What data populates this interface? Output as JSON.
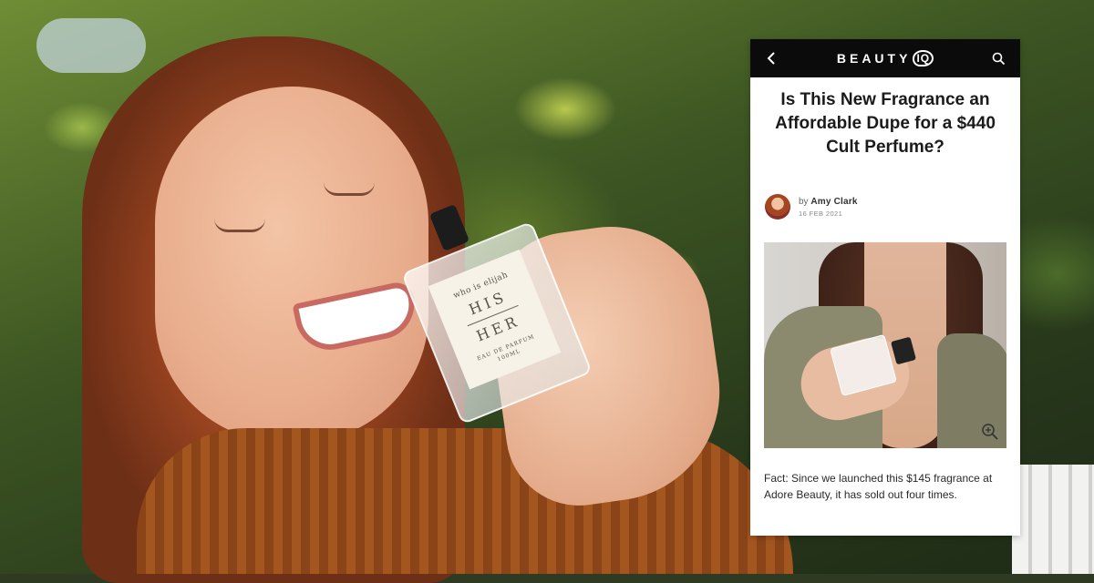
{
  "photo": {
    "bottle_label": {
      "brand": "who is elijah",
      "line1": "HIS",
      "line2": "HER",
      "type": "EAU DE PARFUM",
      "volume": "100ML"
    }
  },
  "article": {
    "brand": {
      "text": "BEAUTY",
      "iq": "IQ"
    },
    "icons": {
      "back": "chevron-left-icon",
      "search": "search-icon",
      "zoom": "zoom-in-icon"
    },
    "headline": "Is This New Fragrance an Affordable Dupe for a $440 Cult Perfume?",
    "byline": {
      "by": "by",
      "author": "Amy Clark",
      "date": "16 FEB 2021"
    },
    "caption": "Fact: Since we launched this $145 fragrance at Adore Beauty, it has sold out four times."
  },
  "colors": {
    "topbar": "#0b0b0b",
    "card": "#ffffff",
    "headline": "#1b1b1b"
  }
}
